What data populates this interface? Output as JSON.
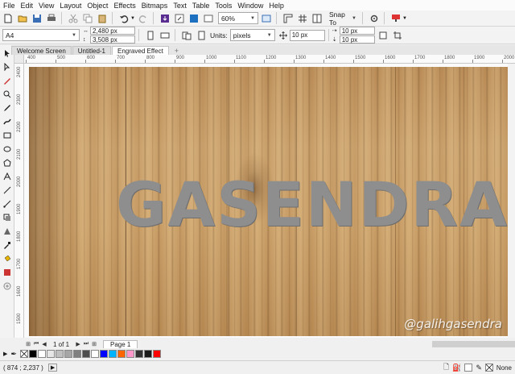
{
  "menu": [
    {
      "label": "File"
    },
    {
      "label": "Edit"
    },
    {
      "label": "View"
    },
    {
      "label": "Layout"
    },
    {
      "label": "Object"
    },
    {
      "label": "Effects"
    },
    {
      "label": "Bitmaps"
    },
    {
      "label": "Text"
    },
    {
      "label": "Table"
    },
    {
      "label": "Tools"
    },
    {
      "label": "Window"
    },
    {
      "label": "Help"
    }
  ],
  "toolbar": {
    "zoom": "60%",
    "snap_to": "Snap To"
  },
  "property_bar": {
    "page_size": "A4",
    "width": "2,480 px",
    "height": "3,508 px",
    "units_label": "Units:",
    "units_value": "pixels",
    "nudge": "10 px",
    "dup_x": "10 px",
    "dup_y": "10 px"
  },
  "tabs": [
    {
      "label": "Welcome Screen"
    },
    {
      "label": "Untitled-1"
    },
    {
      "label": "Engraved Effect"
    }
  ],
  "ruler_h": [
    "400",
    "500",
    "600",
    "700",
    "800",
    "900",
    "1000",
    "1100",
    "1200",
    "1300",
    "1400",
    "1500",
    "1600",
    "1700",
    "1800",
    "1900",
    "2000"
  ],
  "ruler_v": [
    "2400",
    "2300",
    "2200",
    "2100",
    "2000",
    "1900",
    "1800",
    "1700",
    "1600",
    "1500"
  ],
  "artwork": {
    "headline": "GASENDRA",
    "watermark": "@galihgasendra"
  },
  "page_nav": {
    "count": "1 of 1",
    "page_tab": "Page 1"
  },
  "palette": [
    "#000000",
    "#ffffff",
    "#e6e6e6",
    "#bfbfbf",
    "#a6a6a6",
    "#808080",
    "#4d4d4d",
    "#ffffff",
    "#0000ff",
    "#00b3ff",
    "#ff6600",
    "#ff99cc",
    "#333333",
    "#1a1a1a",
    "#ff0000"
  ],
  "status": {
    "coords": "( 874 ; 2,237 )",
    "fill_label": "None"
  }
}
